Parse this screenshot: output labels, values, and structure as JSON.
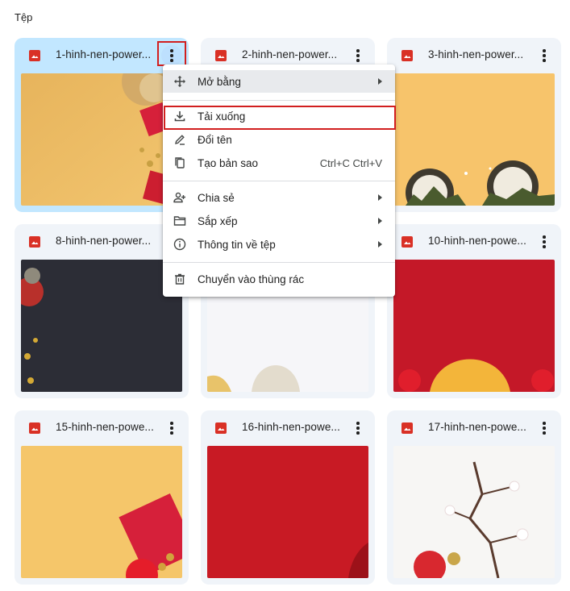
{
  "section": {
    "title": "Tệp"
  },
  "files": [
    {
      "name": "1-hinh-nen-power...",
      "icon": "image-icon"
    },
    {
      "name": "2-hinh-nen-power...",
      "icon": "image-icon"
    },
    {
      "name": "3-hinh-nen-power...",
      "icon": "image-icon"
    },
    {
      "name": "8-hinh-nen-power...",
      "icon": "image-icon"
    },
    {
      "name": "",
      "icon": "image-icon"
    },
    {
      "name": "10-hinh-nen-powe...",
      "icon": "image-icon"
    },
    {
      "name": "15-hinh-nen-powe...",
      "icon": "image-icon"
    },
    {
      "name": "16-hinh-nen-powe...",
      "icon": "image-icon"
    },
    {
      "name": "17-hinh-nen-powe...",
      "icon": "image-icon"
    }
  ],
  "context_menu": {
    "open_with": {
      "label": "Mở bằng",
      "icon": "move-icon"
    },
    "download": {
      "label": "Tải xuống",
      "icon": "download-icon"
    },
    "rename": {
      "label": "Đổi tên",
      "icon": "rename-pencil-icon"
    },
    "copy": {
      "label": "Tạo bản sao",
      "shortcut": "Ctrl+C Ctrl+V",
      "icon": "copy-icon"
    },
    "share": {
      "label": "Chia sẻ",
      "icon": "person-add-icon"
    },
    "organize": {
      "label": "Sắp xếp",
      "icon": "folder-icon"
    },
    "info": {
      "label": "Thông tin về tệp",
      "icon": "info-icon"
    },
    "trash": {
      "label": "Chuyển vào thùng rác",
      "icon": "trash-icon"
    }
  },
  "colors": {
    "selected_card": "#c2e7ff",
    "card": "#f0f4f9",
    "file_icon": "#d93025",
    "highlight": "#d21f1f"
  }
}
